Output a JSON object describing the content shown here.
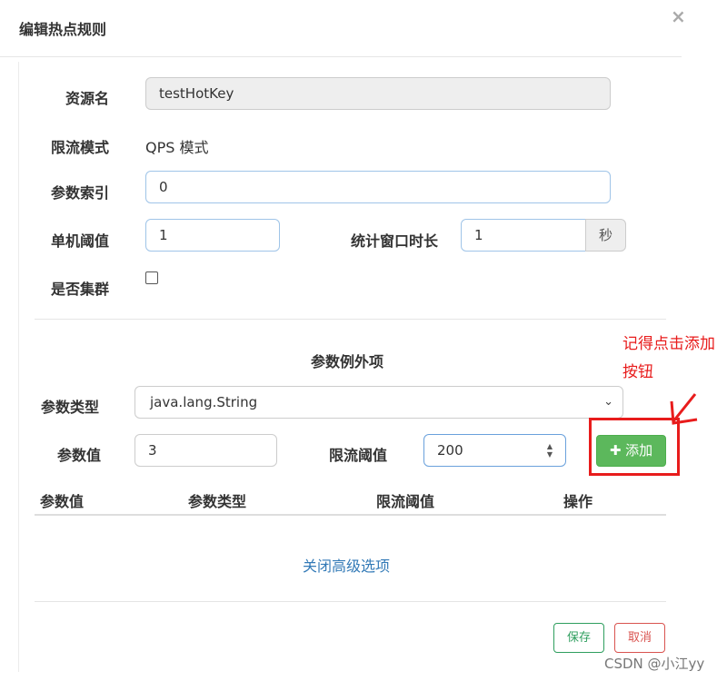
{
  "dialog": {
    "title": "编辑热点规则",
    "close_glyph": "×"
  },
  "form": {
    "resource_label": "资源名",
    "resource_value": "testHotKey",
    "mode_label": "限流模式",
    "mode_value": "QPS 模式",
    "param_index_label": "参数索引",
    "param_index_value": "0",
    "threshold_label": "单机阈值",
    "threshold_value": "1",
    "window_label": "统计窗口时长",
    "window_value": "1",
    "window_unit": "秒",
    "cluster_label": "是否集群",
    "cluster_checked": false
  },
  "exceptions": {
    "title": "参数例外项",
    "type_label": "参数类型",
    "type_selected": "java.lang.String",
    "value_label": "参数值",
    "value_value": "3",
    "limit_label": "限流阈值",
    "limit_value": "200",
    "add_button": "添加",
    "add_icon_glyph": "✚",
    "table_headers": [
      "参数值",
      "参数类型",
      "限流阈值",
      "操作"
    ],
    "rows": []
  },
  "advanced_toggle": "关闭高级选项",
  "footer": {
    "save": "保存",
    "cancel": "取消"
  },
  "annotation": {
    "line1": "记得点击添加",
    "line2": "按钮",
    "color": "#e81c1c"
  },
  "watermark": "CSDN @小江yy",
  "colors": {
    "add_button": "#5cb85c",
    "save_border": "#2e9e5e",
    "cancel_border": "#d9534f",
    "link": "#337ab7"
  }
}
